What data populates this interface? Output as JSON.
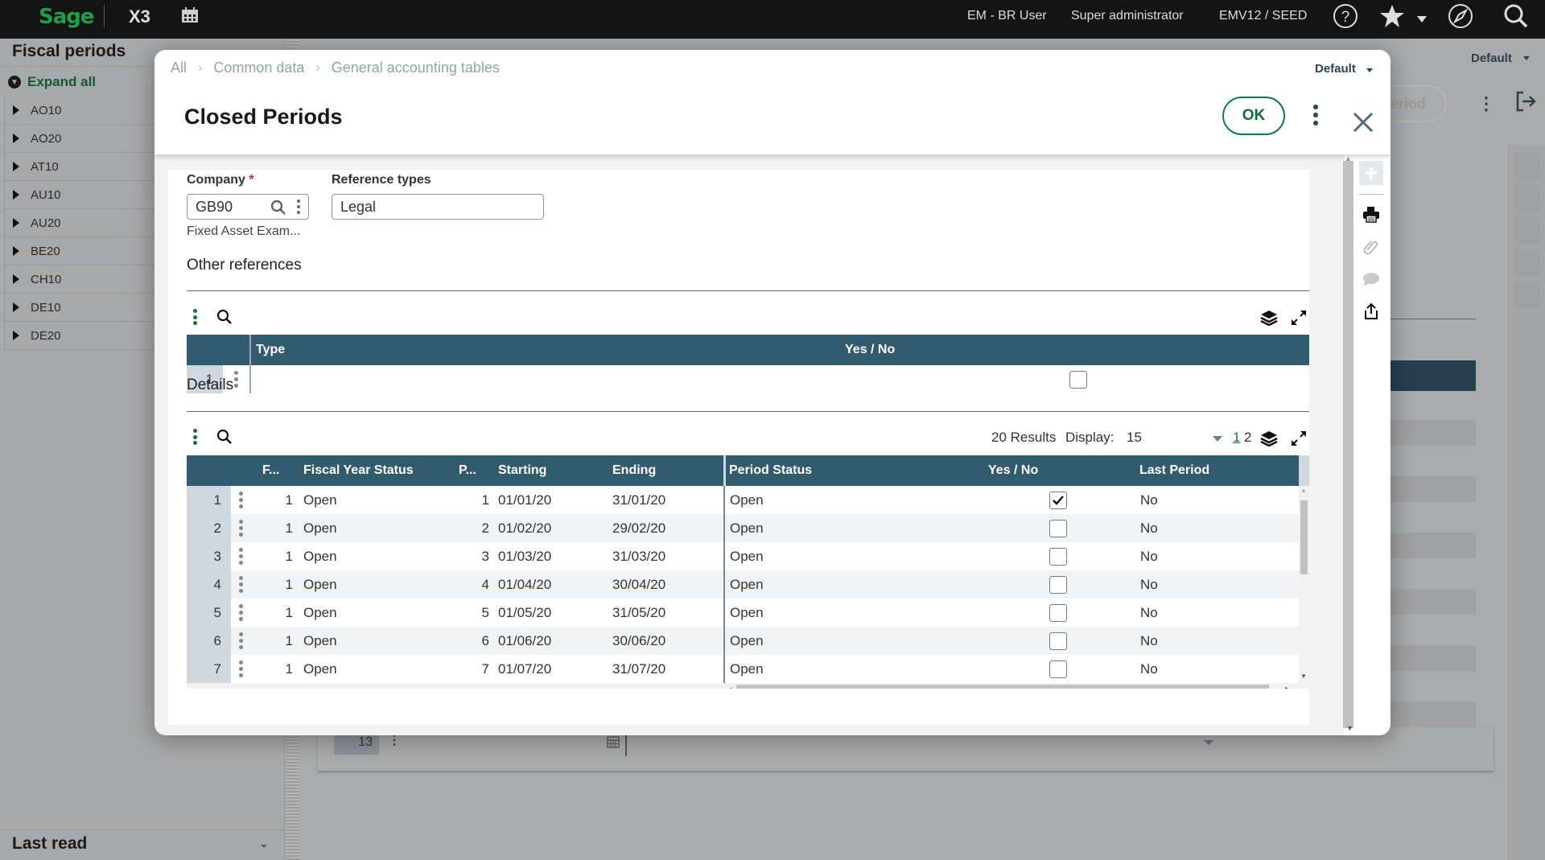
{
  "topbar": {
    "brand": "Sage",
    "product": "X3",
    "user": "EM - BR User",
    "role": "Super administrator",
    "folder": "EMV12 / SEED",
    "icons": [
      "calendar-icon",
      "help-icon",
      "star-icon",
      "compass-icon",
      "search-icon"
    ]
  },
  "sidebar": {
    "title": "Fiscal periods",
    "expand_all": "Expand all",
    "items": [
      "AO10",
      "AO20",
      "AT10",
      "AU10",
      "AU20",
      "BE20",
      "CH10",
      "DE10",
      "DE20"
    ],
    "last_read": "Last read"
  },
  "background": {
    "default_label": "Default",
    "period_button_fragment": "eriod",
    "row_number": "13"
  },
  "modal": {
    "breadcrumb": [
      "All",
      "Common data",
      "General accounting tables"
    ],
    "default_label": "Default",
    "title": "Closed Periods",
    "ok_label": "OK",
    "company": {
      "label": "Company",
      "required_mark": "*",
      "value": "GB90",
      "description": "Fixed Asset Exam..."
    },
    "reference_types": {
      "label": "Reference types",
      "value": "Legal"
    },
    "other_references": {
      "title": "Other references",
      "columns": [
        "Type",
        "Yes / No"
      ],
      "rows": [
        {
          "num": "1",
          "type": "",
          "yes_no": false
        }
      ]
    },
    "details": {
      "title": "Details",
      "results_text": "20 Results",
      "display_label": "Display:",
      "display_value": "15",
      "pages": [
        "1",
        "2"
      ],
      "current_page": "1",
      "columns": [
        "F...",
        "Fiscal Year Status",
        "P...",
        "Starting",
        "Ending",
        "Period Status",
        "Yes / No",
        "Last Period"
      ],
      "rows": [
        {
          "num": "1",
          "fy": "1",
          "fy_status": "Open",
          "p": "1",
          "start": "01/01/20",
          "end": "31/01/20",
          "status": "Open",
          "yes_no": true,
          "last": "No"
        },
        {
          "num": "2",
          "fy": "1",
          "fy_status": "Open",
          "p": "2",
          "start": "01/02/20",
          "end": "29/02/20",
          "status": "Open",
          "yes_no": false,
          "last": "No"
        },
        {
          "num": "3",
          "fy": "1",
          "fy_status": "Open",
          "p": "3",
          "start": "01/03/20",
          "end": "31/03/20",
          "status": "Open",
          "yes_no": false,
          "last": "No"
        },
        {
          "num": "4",
          "fy": "1",
          "fy_status": "Open",
          "p": "4",
          "start": "01/04/20",
          "end": "30/04/20",
          "status": "Open",
          "yes_no": false,
          "last": "No"
        },
        {
          "num": "5",
          "fy": "1",
          "fy_status": "Open",
          "p": "5",
          "start": "01/05/20",
          "end": "31/05/20",
          "status": "Open",
          "yes_no": false,
          "last": "No"
        },
        {
          "num": "6",
          "fy": "1",
          "fy_status": "Open",
          "p": "6",
          "start": "01/06/20",
          "end": "30/06/20",
          "status": "Open",
          "yes_no": false,
          "last": "No"
        },
        {
          "num": "7",
          "fy": "1",
          "fy_status": "Open",
          "p": "7",
          "start": "01/07/20",
          "end": "31/07/20",
          "status": "Open",
          "yes_no": false,
          "last": "No"
        }
      ]
    }
  },
  "colors": {
    "brand_green": "#1fa04a",
    "grid_header": "#335b6e",
    "accent_green": "#0e7c3f",
    "topbar_bg": "#141414"
  }
}
